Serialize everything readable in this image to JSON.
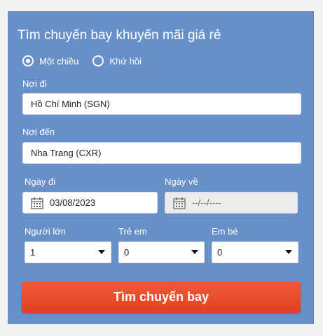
{
  "form": {
    "title": "Tìm chuyến bay khuyến mãi giá rẻ",
    "trip_type": {
      "one_way": "Một chiều",
      "round_trip": "Khứ hồi",
      "selected": "one_way"
    },
    "from": {
      "label": "Nơi đi",
      "value": "Hồ Chí Minh (SGN)"
    },
    "to": {
      "label": "Nơi đến",
      "value": "Nha Trang (CXR)"
    },
    "depart": {
      "label": "Ngày đi",
      "value": "03/08/2023"
    },
    "return": {
      "label": "Ngày về",
      "value": "--/--/----"
    },
    "adults": {
      "label": "Người lớn",
      "value": "1"
    },
    "children": {
      "label": "Trẻ em",
      "value": "0"
    },
    "infants": {
      "label": "Em bé",
      "value": "0"
    },
    "search_button": "Tìm chuyến bay"
  },
  "colors": {
    "panel": "#6890c8",
    "button": "#e84b28",
    "background": "#f1f1f1"
  },
  "icons": {
    "date": "calendar-icon",
    "dropdown": "caret-down-icon"
  }
}
